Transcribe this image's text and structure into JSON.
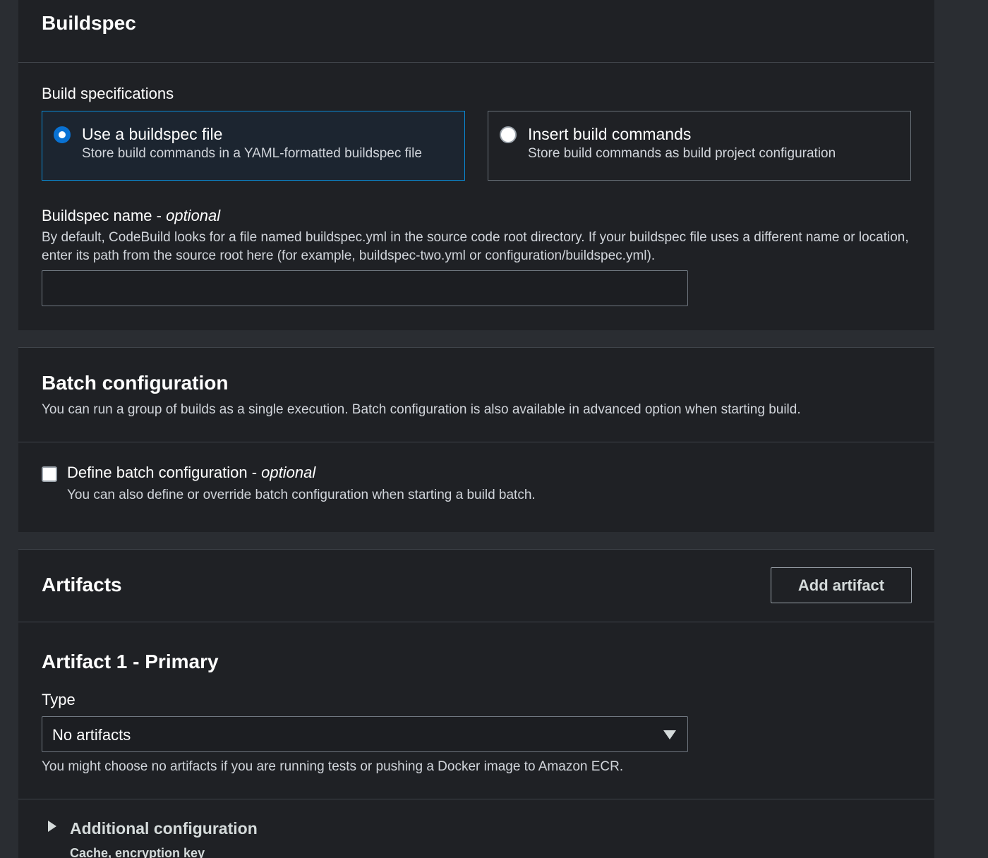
{
  "buildspec": {
    "title": "Buildspec",
    "spec_label": "Build specifications",
    "options": [
      {
        "title": "Use a buildspec file",
        "description": "Store build commands in a YAML-formatted buildspec file",
        "selected": true
      },
      {
        "title": "Insert build commands",
        "description": "Store build commands as build project configuration",
        "selected": false
      }
    ],
    "name_label": "Buildspec name - ",
    "name_optional": "optional",
    "name_description": "By default, CodeBuild looks for a file named buildspec.yml in the source code root directory. If your buildspec file uses a different name or location, enter its path from the source root here (for example, buildspec-two.yml or configuration/buildspec.yml).",
    "name_value": ""
  },
  "batch": {
    "title": "Batch configuration",
    "description": "You can run a group of builds as a single execution. Batch configuration is also available in advanced option when starting build.",
    "checkbox_label": "Define batch configuration - ",
    "checkbox_optional": "optional",
    "checkbox_description": "You can also define or override batch configuration when starting a build batch.",
    "checked": false
  },
  "artifacts": {
    "title": "Artifacts",
    "add_button": "Add artifact",
    "artifact_title": "Artifact 1 - Primary",
    "type_label": "Type",
    "type_value": "No artifacts",
    "type_hint": "You might choose no artifacts if you are running tests or pushing a Docker image to Amazon ECR.",
    "additional_title": "Additional configuration",
    "additional_desc": "Cache, encryption key"
  },
  "colors": {
    "panel_bg": "#1f2125",
    "page_bg": "#2a2d32",
    "accent": "#0972d3",
    "selected_border": "#0a8bd6"
  }
}
